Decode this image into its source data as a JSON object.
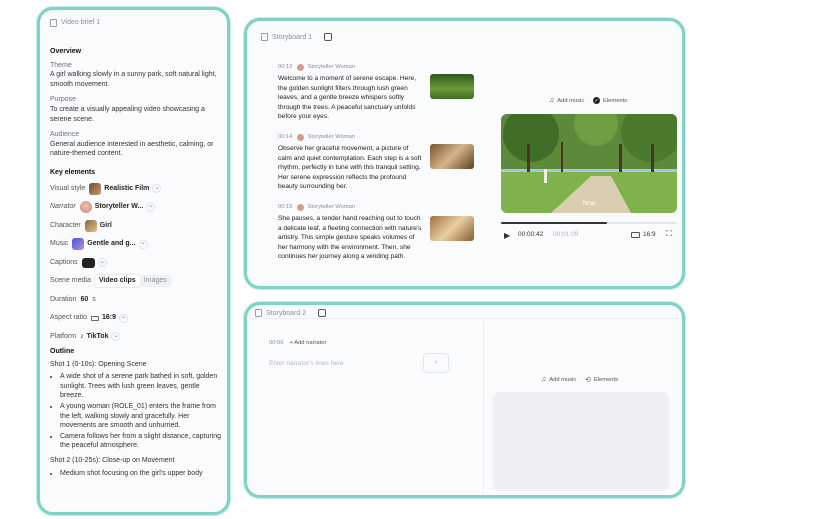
{
  "brief": {
    "title": "Video brief 1",
    "overview_heading": "Overview",
    "theme_label": "Theme",
    "theme_text": "A girl walking slowly in a sunny park, soft natural light, smooth movement.",
    "purpose_label": "Purpose",
    "purpose_text": "To create a visually appealing video showcasing a serene scene.",
    "audience_label": "Audience",
    "audience_text": "General audience interested in aesthetic, calming, or nature-themed content.",
    "key_heading": "Key elements",
    "visual_label": "Visual style",
    "visual_value": "Realistic Film",
    "narrator_label": "Narrator",
    "narrator_value": "Storyteller W...",
    "character_label": "Character",
    "character_value": "Girl",
    "music_label": "Music",
    "music_value": "Gentle and g...",
    "captions_label": "Captions",
    "scene_media_label": "Scene media",
    "media_opt1": "Video clips",
    "media_opt2": "Images",
    "duration_label": "Duration",
    "duration_value": "60",
    "duration_unit": "s",
    "aspect_label": "Aspect ratio",
    "aspect_value": "16:9",
    "platform_label": "Platform",
    "platform_value": "TikTok",
    "outline_heading": "Outline",
    "shot1_title": "Shot 1 (0-10s): Opening Scene",
    "shot1_bullets": [
      "A wide shot of a serene park bathed in soft, golden sunlight. Trees with lush green leaves, gentle breeze.",
      "A young woman (ROLE_01) enters the frame from the left, walking slowly and gracefully. Her movements are smooth and unhurried.",
      "Camera follows her from a slight distance, capturing the peaceful atmosphere."
    ],
    "shot2_title": "Shot 2 (10-25s): Close-up on Movement",
    "shot2_bullets": [
      "Medium shot focusing on the girl's upper body"
    ]
  },
  "storyboard1": {
    "title": "Storyboard 1",
    "scenes": [
      {
        "time": "00:12",
        "narrator": "Storyteller Woman",
        "text": "Welcome to a moment of serene escape. Here, the golden sunlight filters through lush green leaves, and a gentle breeze whispers softly through the trees. A peaceful sanctuary unfolds before your eyes."
      },
      {
        "time": "00:14",
        "narrator": "Storyteller Woman",
        "text": "Observe her graceful movement, a picture of calm and quiet contemplation. Each step is a soft rhythm, perfectly in tune with this tranquil setting. Her serene expression reflects the profound beauty surrounding her."
      },
      {
        "time": "00:15",
        "narrator": "Storyteller Woman",
        "text": "She pauses, a tender hand reaching out to touch a delicate leaf, a fleeting connection with nature's artistry. This simple gesture speaks volumes of her harmony with the environment. Then, she continues her journey along a winding path."
      }
    ],
    "add_music": "Add music",
    "elements": "Elements",
    "video_label": "Now",
    "current_time": "00:00:42",
    "total_time": "00:01:09",
    "progress": 0.6,
    "aspect": "16:9"
  },
  "storyboard2": {
    "title": "Storyboard 2",
    "time": "00:06",
    "add_narrator": "Add narrator",
    "placeholder": "Enter narrator's lines here",
    "add_music": "Add music",
    "elements": "Elements"
  },
  "colors": {
    "border": "#7fd3c6",
    "panel_bg": "#fafbfd"
  }
}
